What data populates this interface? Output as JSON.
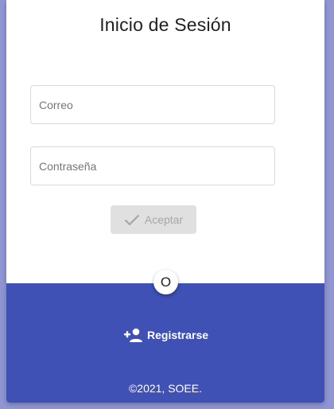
{
  "login": {
    "title": "Inicio de Sesión",
    "email_placeholder": "Correo",
    "password_placeholder": "Contraseña",
    "accept_label": "Aceptar"
  },
  "divider": {
    "label": "O"
  },
  "footer": {
    "register_label": "Registrarse",
    "copyright": "©2021, SOEE."
  },
  "icons": {
    "accept": "check-icon",
    "register": "person-add-icon"
  },
  "colors": {
    "background": "#8f96d3",
    "footer": "#3f51b5",
    "button_disabled": "#e0e0e0"
  }
}
